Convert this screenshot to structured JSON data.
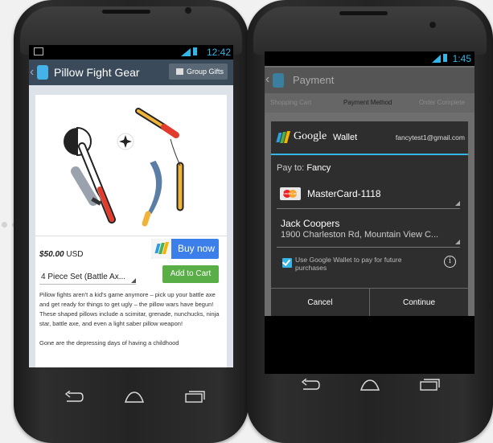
{
  "left_phone": {
    "status_time": "12:42",
    "title": "Pillow Fight Gear",
    "group_gifts_label": "Group Gifts",
    "price_amount": "$50.00",
    "price_currency": "USD",
    "buy_now_label": "Buy now",
    "variant_value": "4 Piece Set (Battle Ax...",
    "add_to_cart_label": "Add to Cart",
    "description_p1": "Pillow fights aren't a kid's game anymore – pick up your battle axe and get ready for things to get ugly – the pillow wars have begun! These shaped pillows include a scimitar, grenade, nunchucks, ninja star, battle axe, and even a light saber pillow weapon!",
    "description_p2": "Gone are the depressing days of having a childhood"
  },
  "right_phone": {
    "status_time": "1:45",
    "title": "Payment",
    "steps": [
      "Shopping Cart",
      "Payment Method",
      "Order Complete"
    ],
    "wallet_brand": "Google",
    "wallet_product": "Wallet",
    "account_email": "fancytest1@gmail.com",
    "pay_to_label": "Pay to:",
    "pay_to_merchant": "Fancy",
    "card_name": "MasterCard-1118",
    "card_logo_text": "MasterCard",
    "address_name": "Jack Coopers",
    "address_line": "1900 Charleston Rd, Mountain View C...",
    "checkbox_label": "Use Google Wallet to pay for future purchases",
    "checkbox_checked": true,
    "cancel_label": "Cancel",
    "continue_label": "Continue"
  },
  "colors": {
    "accent_blue": "#33b5e5",
    "buy_blue": "#3d7fea",
    "add_green": "#5aae47"
  }
}
